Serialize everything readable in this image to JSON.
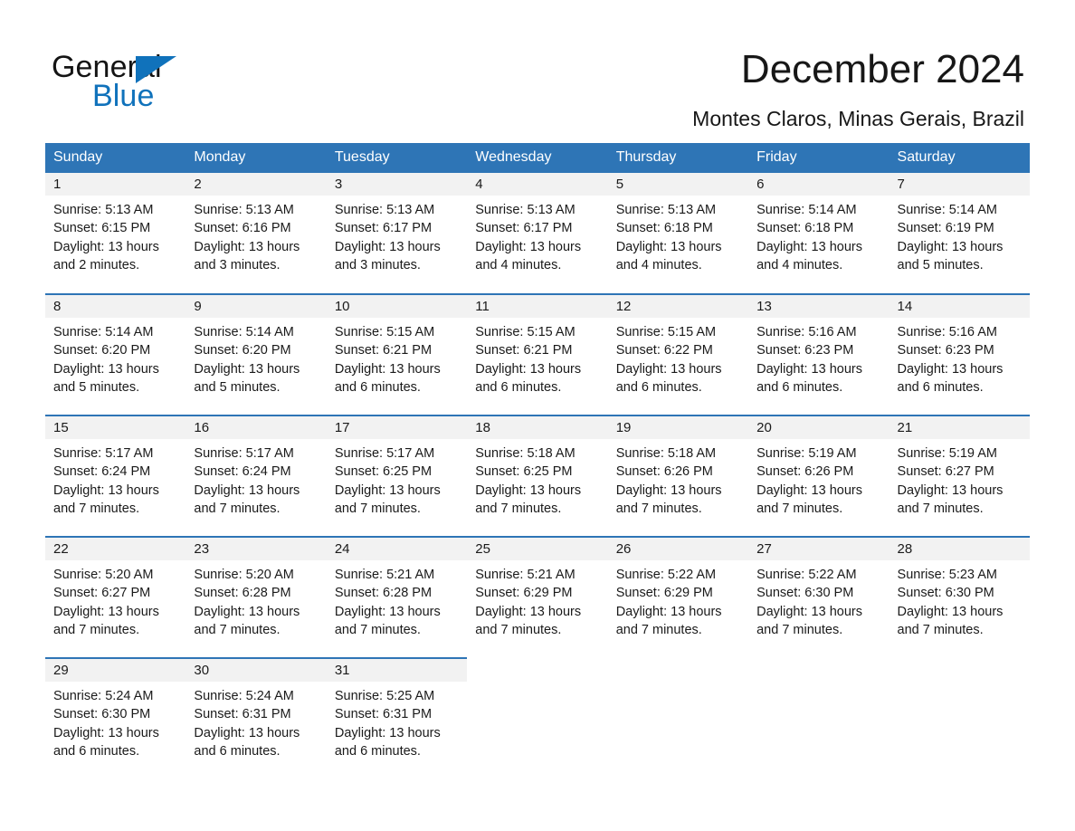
{
  "brand": {
    "name_part1": "General",
    "name_part2": "Blue",
    "triangle_icon": "brand-triangle-icon",
    "primary_color": "#1072bb"
  },
  "header": {
    "title": "December 2024",
    "subtitle": "Montes Claros, Minas Gerais, Brazil"
  },
  "calendar": {
    "header_color": "#2e75b6",
    "daynum_band_color": "#f2f2f2",
    "weekday_headers": [
      "Sunday",
      "Monday",
      "Tuesday",
      "Wednesday",
      "Thursday",
      "Friday",
      "Saturday"
    ],
    "weeks": [
      [
        {
          "day": "1",
          "sunrise": "Sunrise: 5:13 AM",
          "sunset": "Sunset: 6:15 PM",
          "daylight": "Daylight: 13 hours and 2 minutes."
        },
        {
          "day": "2",
          "sunrise": "Sunrise: 5:13 AM",
          "sunset": "Sunset: 6:16 PM",
          "daylight": "Daylight: 13 hours and 3 minutes."
        },
        {
          "day": "3",
          "sunrise": "Sunrise: 5:13 AM",
          "sunset": "Sunset: 6:17 PM",
          "daylight": "Daylight: 13 hours and 3 minutes."
        },
        {
          "day": "4",
          "sunrise": "Sunrise: 5:13 AM",
          "sunset": "Sunset: 6:17 PM",
          "daylight": "Daylight: 13 hours and 4 minutes."
        },
        {
          "day": "5",
          "sunrise": "Sunrise: 5:13 AM",
          "sunset": "Sunset: 6:18 PM",
          "daylight": "Daylight: 13 hours and 4 minutes."
        },
        {
          "day": "6",
          "sunrise": "Sunrise: 5:14 AM",
          "sunset": "Sunset: 6:18 PM",
          "daylight": "Daylight: 13 hours and 4 minutes."
        },
        {
          "day": "7",
          "sunrise": "Sunrise: 5:14 AM",
          "sunset": "Sunset: 6:19 PM",
          "daylight": "Daylight: 13 hours and 5 minutes."
        }
      ],
      [
        {
          "day": "8",
          "sunrise": "Sunrise: 5:14 AM",
          "sunset": "Sunset: 6:20 PM",
          "daylight": "Daylight: 13 hours and 5 minutes."
        },
        {
          "day": "9",
          "sunrise": "Sunrise: 5:14 AM",
          "sunset": "Sunset: 6:20 PM",
          "daylight": "Daylight: 13 hours and 5 minutes."
        },
        {
          "day": "10",
          "sunrise": "Sunrise: 5:15 AM",
          "sunset": "Sunset: 6:21 PM",
          "daylight": "Daylight: 13 hours and 6 minutes."
        },
        {
          "day": "11",
          "sunrise": "Sunrise: 5:15 AM",
          "sunset": "Sunset: 6:21 PM",
          "daylight": "Daylight: 13 hours and 6 minutes."
        },
        {
          "day": "12",
          "sunrise": "Sunrise: 5:15 AM",
          "sunset": "Sunset: 6:22 PM",
          "daylight": "Daylight: 13 hours and 6 minutes."
        },
        {
          "day": "13",
          "sunrise": "Sunrise: 5:16 AM",
          "sunset": "Sunset: 6:23 PM",
          "daylight": "Daylight: 13 hours and 6 minutes."
        },
        {
          "day": "14",
          "sunrise": "Sunrise: 5:16 AM",
          "sunset": "Sunset: 6:23 PM",
          "daylight": "Daylight: 13 hours and 6 minutes."
        }
      ],
      [
        {
          "day": "15",
          "sunrise": "Sunrise: 5:17 AM",
          "sunset": "Sunset: 6:24 PM",
          "daylight": "Daylight: 13 hours and 7 minutes."
        },
        {
          "day": "16",
          "sunrise": "Sunrise: 5:17 AM",
          "sunset": "Sunset: 6:24 PM",
          "daylight": "Daylight: 13 hours and 7 minutes."
        },
        {
          "day": "17",
          "sunrise": "Sunrise: 5:17 AM",
          "sunset": "Sunset: 6:25 PM",
          "daylight": "Daylight: 13 hours and 7 minutes."
        },
        {
          "day": "18",
          "sunrise": "Sunrise: 5:18 AM",
          "sunset": "Sunset: 6:25 PM",
          "daylight": "Daylight: 13 hours and 7 minutes."
        },
        {
          "day": "19",
          "sunrise": "Sunrise: 5:18 AM",
          "sunset": "Sunset: 6:26 PM",
          "daylight": "Daylight: 13 hours and 7 minutes."
        },
        {
          "day": "20",
          "sunrise": "Sunrise: 5:19 AM",
          "sunset": "Sunset: 6:26 PM",
          "daylight": "Daylight: 13 hours and 7 minutes."
        },
        {
          "day": "21",
          "sunrise": "Sunrise: 5:19 AM",
          "sunset": "Sunset: 6:27 PM",
          "daylight": "Daylight: 13 hours and 7 minutes."
        }
      ],
      [
        {
          "day": "22",
          "sunrise": "Sunrise: 5:20 AM",
          "sunset": "Sunset: 6:27 PM",
          "daylight": "Daylight: 13 hours and 7 minutes."
        },
        {
          "day": "23",
          "sunrise": "Sunrise: 5:20 AM",
          "sunset": "Sunset: 6:28 PM",
          "daylight": "Daylight: 13 hours and 7 minutes."
        },
        {
          "day": "24",
          "sunrise": "Sunrise: 5:21 AM",
          "sunset": "Sunset: 6:28 PM",
          "daylight": "Daylight: 13 hours and 7 minutes."
        },
        {
          "day": "25",
          "sunrise": "Sunrise: 5:21 AM",
          "sunset": "Sunset: 6:29 PM",
          "daylight": "Daylight: 13 hours and 7 minutes."
        },
        {
          "day": "26",
          "sunrise": "Sunrise: 5:22 AM",
          "sunset": "Sunset: 6:29 PM",
          "daylight": "Daylight: 13 hours and 7 minutes."
        },
        {
          "day": "27",
          "sunrise": "Sunrise: 5:22 AM",
          "sunset": "Sunset: 6:30 PM",
          "daylight": "Daylight: 13 hours and 7 minutes."
        },
        {
          "day": "28",
          "sunrise": "Sunrise: 5:23 AM",
          "sunset": "Sunset: 6:30 PM",
          "daylight": "Daylight: 13 hours and 7 minutes."
        }
      ],
      [
        {
          "day": "29",
          "sunrise": "Sunrise: 5:24 AM",
          "sunset": "Sunset: 6:30 PM",
          "daylight": "Daylight: 13 hours and 6 minutes."
        },
        {
          "day": "30",
          "sunrise": "Sunrise: 5:24 AM",
          "sunset": "Sunset: 6:31 PM",
          "daylight": "Daylight: 13 hours and 6 minutes."
        },
        {
          "day": "31",
          "sunrise": "Sunrise: 5:25 AM",
          "sunset": "Sunset: 6:31 PM",
          "daylight": "Daylight: 13 hours and 6 minutes."
        },
        {
          "day": "",
          "sunrise": "",
          "sunset": "",
          "daylight": ""
        },
        {
          "day": "",
          "sunrise": "",
          "sunset": "",
          "daylight": ""
        },
        {
          "day": "",
          "sunrise": "",
          "sunset": "",
          "daylight": ""
        },
        {
          "day": "",
          "sunrise": "",
          "sunset": "",
          "daylight": ""
        }
      ]
    ]
  }
}
